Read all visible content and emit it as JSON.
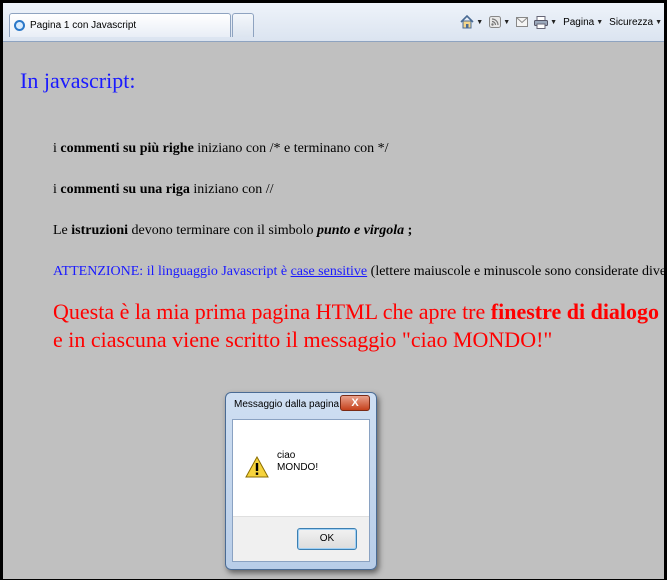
{
  "browser": {
    "tab_title": "Pagina 1 con Javascript",
    "toolbar": {
      "page_label": "Pagina",
      "security_label": "Sicurezza"
    }
  },
  "page": {
    "heading": "In javascript:",
    "lines": {
      "l1": {
        "a": "i ",
        "b": "commenti su più righe",
        "c": " iniziano con /* e terminano con */"
      },
      "l2": {
        "a": "i ",
        "b": "commenti su una riga",
        "c": " iniziano con //"
      },
      "l3": {
        "a": "Le ",
        "b": "istruzioni",
        "c": " devono terminare con il simbolo ",
        "d": "punto e virgola",
        "e": " ;"
      },
      "l4": {
        "a": "ATTENZIONE: il linguaggio Javascript è ",
        "link": "case sensitive",
        "b": " (lettere maiuscole e minuscole sono considerate diverse)"
      }
    },
    "red": {
      "r1a": "Questa è la mia prima pagina HTML che apre tre ",
      "r1b": "finestre di dialogo",
      "r2": "e in ciascuna viene scritto il messaggio \"ciao MONDO!\""
    }
  },
  "dialog": {
    "title": "Messaggio dalla pagina ...",
    "close": "X",
    "message_line1": "ciao",
    "message_line2": "MONDO!",
    "ok_label": "OK"
  }
}
